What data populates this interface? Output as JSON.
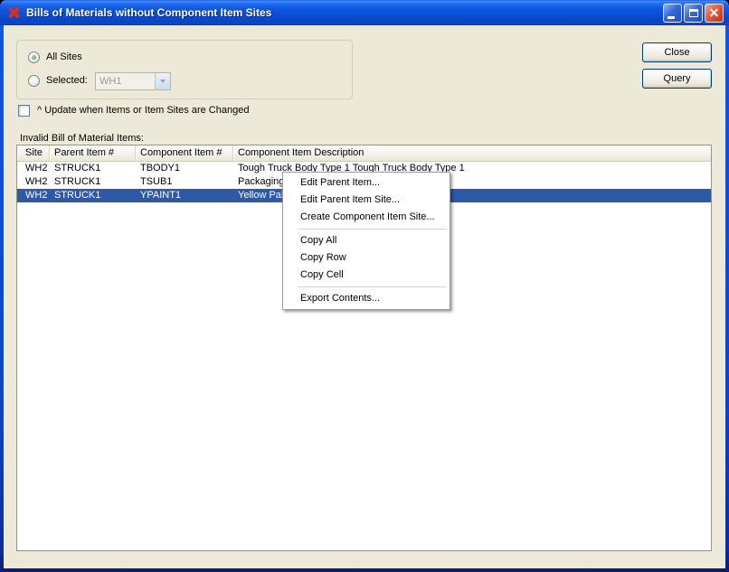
{
  "window": {
    "title": "Bills of Materials without Component Item Sites"
  },
  "site_filter": {
    "all_sites_label": "All Sites",
    "selected_label": "Selected:",
    "site_value": "WH1"
  },
  "actions": {
    "close_label": "Close",
    "query_label": "Query"
  },
  "options": {
    "update_label": "^ Update when Items or Item Sites are Changed"
  },
  "list": {
    "label": "Invalid Bill of Material Items:",
    "columns": [
      "Site",
      "Parent Item #",
      "Component Item #",
      "Component Item Description"
    ],
    "rows": [
      [
        "WH2",
        "STRUCK1",
        "TBODY1",
        "Tough Truck Body Type 1 Tough Truck Body Type 1"
      ],
      [
        "WH2",
        "STRUCK1",
        "TSUB1",
        "Packaging"
      ],
      [
        "WH2",
        "STRUCK1",
        "YPAINT1",
        "Yellow Pain"
      ]
    ]
  },
  "context_menu": {
    "items": [
      "Edit Parent Item...",
      "Edit Parent Item Site...",
      "Create Component Item Site...",
      "Copy All",
      "Copy Row",
      "Copy Cell",
      "Export Contents..."
    ]
  },
  "colors": {
    "window_bg": "#ECE9D8",
    "selection_blue": "#2E58A8",
    "titlebar_blue": "#0A4ED4"
  }
}
